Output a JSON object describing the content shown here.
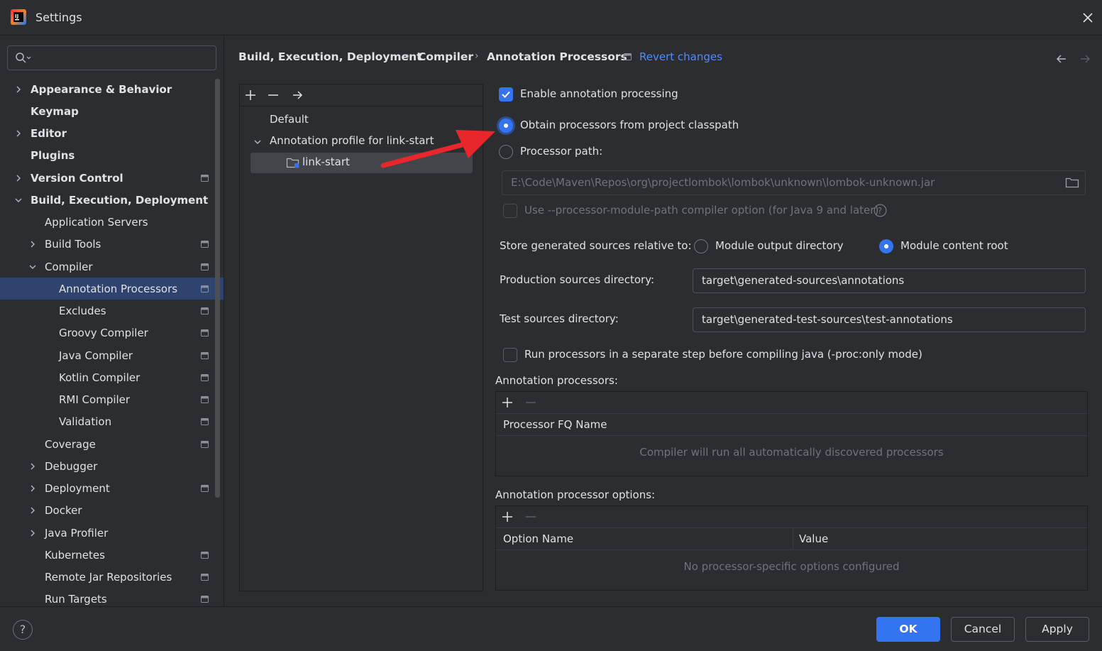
{
  "window": {
    "title": "Settings"
  },
  "search": {
    "placeholder": ""
  },
  "sidebar": {
    "items": [
      {
        "label": "Appearance & Behavior",
        "bold": true,
        "level": 0,
        "chevron": "right",
        "page_icon": false
      },
      {
        "label": "Keymap",
        "bold": true,
        "level": 0,
        "chevron": "none",
        "page_icon": false
      },
      {
        "label": "Editor",
        "bold": true,
        "level": 0,
        "chevron": "right",
        "page_icon": false
      },
      {
        "label": "Plugins",
        "bold": true,
        "level": 0,
        "chevron": "none",
        "page_icon": false
      },
      {
        "label": "Version Control",
        "bold": true,
        "level": 0,
        "chevron": "right",
        "page_icon": true
      },
      {
        "label": "Build, Execution, Deployment",
        "bold": true,
        "level": 0,
        "chevron": "down",
        "page_icon": false
      },
      {
        "label": "Application Servers",
        "bold": false,
        "level": 1,
        "chevron": "none",
        "page_icon": false
      },
      {
        "label": "Build Tools",
        "bold": false,
        "level": 1,
        "chevron": "right",
        "page_icon": true
      },
      {
        "label": "Compiler",
        "bold": false,
        "level": 1,
        "chevron": "down",
        "page_icon": true
      },
      {
        "label": "Annotation Processors",
        "bold": false,
        "level": 2,
        "chevron": "none",
        "page_icon": true,
        "selected": true
      },
      {
        "label": "Excludes",
        "bold": false,
        "level": 2,
        "chevron": "none",
        "page_icon": true
      },
      {
        "label": "Groovy Compiler",
        "bold": false,
        "level": 2,
        "chevron": "none",
        "page_icon": true
      },
      {
        "label": "Java Compiler",
        "bold": false,
        "level": 2,
        "chevron": "none",
        "page_icon": true
      },
      {
        "label": "Kotlin Compiler",
        "bold": false,
        "level": 2,
        "chevron": "none",
        "page_icon": true
      },
      {
        "label": "RMI Compiler",
        "bold": false,
        "level": 2,
        "chevron": "none",
        "page_icon": true
      },
      {
        "label": "Validation",
        "bold": false,
        "level": 2,
        "chevron": "none",
        "page_icon": true
      },
      {
        "label": "Coverage",
        "bold": false,
        "level": 1,
        "chevron": "none",
        "page_icon": true
      },
      {
        "label": "Debugger",
        "bold": false,
        "level": 1,
        "chevron": "right",
        "page_icon": false
      },
      {
        "label": "Deployment",
        "bold": false,
        "level": 1,
        "chevron": "right",
        "page_icon": true
      },
      {
        "label": "Docker",
        "bold": false,
        "level": 1,
        "chevron": "right",
        "page_icon": false
      },
      {
        "label": "Java Profiler",
        "bold": false,
        "level": 1,
        "chevron": "right",
        "page_icon": false
      },
      {
        "label": "Kubernetes",
        "bold": false,
        "level": 1,
        "chevron": "none",
        "page_icon": true
      },
      {
        "label": "Remote Jar Repositories",
        "bold": false,
        "level": 1,
        "chevron": "none",
        "page_icon": true
      },
      {
        "label": "Run Targets",
        "bold": false,
        "level": 1,
        "chevron": "none",
        "page_icon": true
      }
    ]
  },
  "breadcrumb": {
    "items": [
      "Build, Execution, Deployment",
      "Compiler",
      "Annotation Processors"
    ],
    "separator": "›",
    "revert_label": "Revert changes"
  },
  "profiles": {
    "default_label": "Default",
    "profile_label": "Annotation profile for link-start",
    "module_label": "link-start"
  },
  "settings": {
    "enable_processing": {
      "label": "Enable annotation processing",
      "checked": true
    },
    "obtain_from_classpath": {
      "label": "Obtain processors from project classpath",
      "selected": true
    },
    "processor_path": {
      "label": "Processor path:",
      "selected": false,
      "value": "E:\\Code\\Maven\\Repos\\org\\projectlombok\\lombok\\unknown\\lombok-unknown.jar"
    },
    "module_path_option": {
      "label": "Use --processor-module-path compiler option (for Java 9 and later)",
      "checked": false
    },
    "store_relative": {
      "label": "Store generated sources relative to:",
      "option_output": "Module output directory",
      "option_content": "Module content root",
      "selected": "Module content root"
    },
    "production_dir": {
      "label": "Production sources directory:",
      "value": "target\\generated-sources\\annotations"
    },
    "test_dir": {
      "label": "Test sources directory:",
      "value": "target\\generated-test-sources\\test-annotations"
    },
    "separate_step": {
      "label": "Run processors in a separate step before compiling java (-proc:only mode)",
      "checked": false
    }
  },
  "processors_table": {
    "title": "Annotation processors:",
    "column": "Processor FQ Name",
    "empty_text": "Compiler will run all automatically discovered processors"
  },
  "options_table": {
    "title": "Annotation processor options:",
    "col_name": "Option Name",
    "col_value": "Value",
    "empty_text": "No processor-specific options configured"
  },
  "buttons": {
    "ok": "OK",
    "cancel": "Cancel",
    "apply": "Apply",
    "help": "?"
  },
  "colors": {
    "accent": "#3574f0",
    "link": "#548af7",
    "selection": "#2e436e",
    "annotation_arrow": "#e8262c"
  }
}
